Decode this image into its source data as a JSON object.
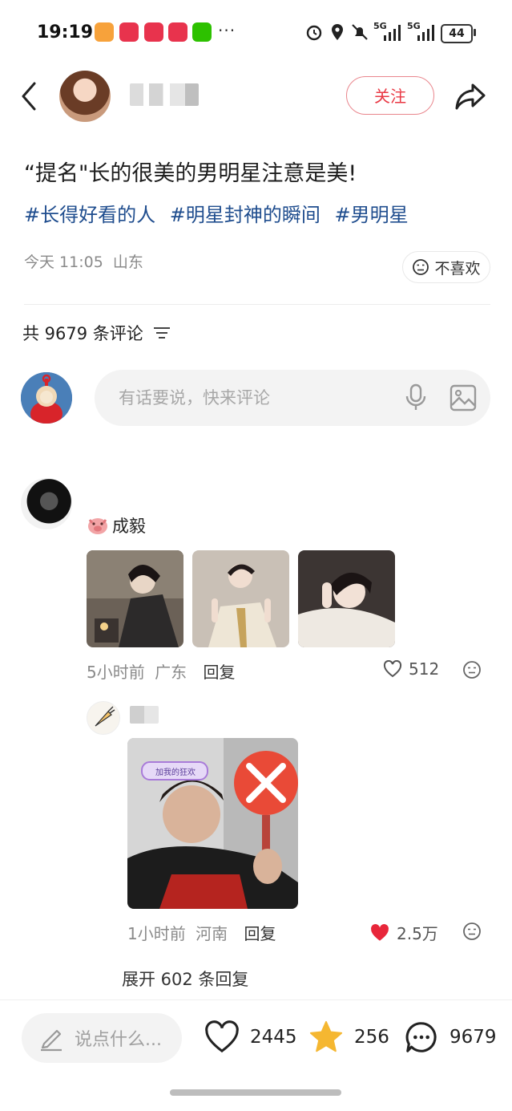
{
  "status_bar": {
    "time": "19:19",
    "more": "···",
    "network_1": "5G",
    "network_2": "5G",
    "battery": "44",
    "app_icons": [
      "taobao-app-icon",
      "pinduoduo-app-icon",
      "pinduoduo-app-icon",
      "pinduoduo-app-icon",
      "wechat-app-icon"
    ]
  },
  "header": {
    "back_icon": "chevron-left-icon",
    "follow_label": "关注",
    "share_icon": "share-icon"
  },
  "post": {
    "title": "“提名\"长的很美的男明星注意是美!",
    "tags": [
      "#长得好看的人",
      "#明星封神的瞬间",
      "#男明星"
    ],
    "time": "今天 11:05",
    "location": "山东",
    "dislike_label": "不喜欢"
  },
  "comments_header": {
    "count_label": "共 9679 条评论"
  },
  "comment_input": {
    "placeholder": "有话要说，快来评论"
  },
  "comments": [
    {
      "name": "成毅",
      "time": "5小时前",
      "location": "广东",
      "reply_label": "回复",
      "likes": "512",
      "image_count": 3
    }
  ],
  "reply": {
    "time": "1小时前",
    "location": "河南",
    "reply_label": "回复",
    "likes": "2.5万",
    "image_badge": "加我的狂欢",
    "expand_label": "展开 602 条回复"
  },
  "bottom_bar": {
    "say_placeholder": "说点什么...",
    "like_count": "2445",
    "star_count": "256",
    "comment_count": "9679"
  },
  "colors": {
    "accent_red": "#e93844",
    "tag_blue": "#1f4d8e",
    "like_red": "#e8263a",
    "star_yellow": "#f5b731"
  }
}
